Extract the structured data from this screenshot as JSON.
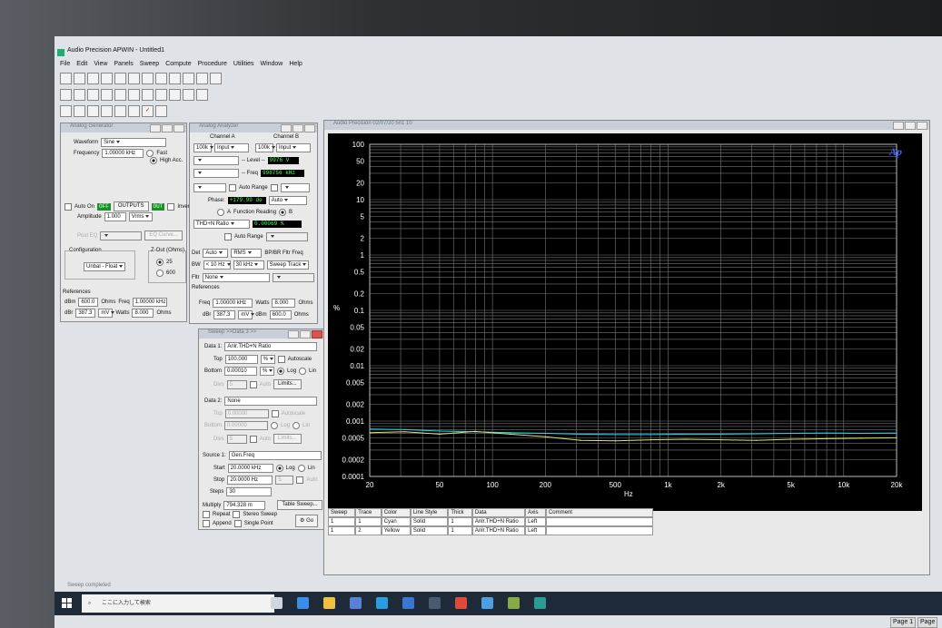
{
  "app": {
    "title": "Audio Precision APWIN - Untitled1",
    "menu": [
      "File",
      "Edit",
      "View",
      "Panels",
      "Sweep",
      "Compute",
      "Procedure",
      "Utilities",
      "Window",
      "Help"
    ]
  },
  "generator": {
    "title": "Analog Generator",
    "waveform_label": "Waveform",
    "waveform_value": "Sine",
    "frequency_label": "Frequency",
    "frequency_value": "1.00000 kHz",
    "fast_label": "Fast",
    "highacc_label": "High Acc.",
    "auto_on_label": "Auto On",
    "off_label": "OFF",
    "outputs_label": "OUTPUTS",
    "out_label": "OUT",
    "invert_label": "Invert",
    "amplitude_label": "Amplitude",
    "amplitude_value": "1.000",
    "amplitude_unit": "Vrms",
    "post_eq_label": "Post EQ",
    "eq_curve_label": "EQ Curve...",
    "configuration_label": "Configuration",
    "configuration_value": "Unbal - Float",
    "zout_label": "Z-Out (Ohms)",
    "z25": "25",
    "z600": "600",
    "references_label": "References",
    "dbm_label": "dBm",
    "dbm_value": "600.0",
    "ohms": "Ohms",
    "freq_label": "Freq",
    "freq_value": "1.00000 kHz",
    "dbv_label": "dBr",
    "dbv_value": "387.3",
    "dbv_unit": "mV",
    "watts_label": "Watts",
    "watts_value": "8.000",
    "watts_unit": "Ohms"
  },
  "analyzer": {
    "title": "Analog Analyzer",
    "ch_a": "Channel A",
    "ch_b": "Channel B",
    "range_a": "100k",
    "input_a": "Input",
    "range_b": "100k",
    "input_b": "Input",
    "level_label": "-- Level --",
    "level_value": "9976",
    "level_unit": "V",
    "freq_label": "-- Freq",
    "freq_value": "998756 kHz",
    "auto_range_label": "Auto Range",
    "phase_label": "Phase:",
    "phase_value": "+179.99",
    "phase_unit": "de",
    "phase_auto": "Auto",
    "func_a": "A",
    "func_reading_label": "Function Reading",
    "func_b": "B",
    "thd_label": "THD+N Ratio",
    "thd_value": "0.00069",
    "thd_unit": "%",
    "det_label": "Det",
    "det_value": "Auto",
    "rms_value": "RMS",
    "bpbr_label": "BP/BR Fltr Freq",
    "bw_label": "BW",
    "bw_low": "< 10 Hz",
    "bw_high": "30 kHz",
    "sweep_track": "Sweep Track",
    "fltr_label": "Fltr",
    "fltr_value": "None",
    "references_label": "References",
    "ref_freq_label": "Freq",
    "ref_freq_value": "1.00000 kHz",
    "ref_watts_label": "Watts",
    "ref_watts_value": "8.000",
    "ref_ohms": "Ohms",
    "ref_dbr_label": "dBr",
    "ref_dbr_value": "387.3",
    "ref_dbr_unit": "mV",
    "ref_dbm_label": "dBm",
    "ref_dbm_value": "600.0",
    "ref_dbm_unit": "Ohms"
  },
  "sweep": {
    "title": "Sweep >>Data 3 >>",
    "data1_label": "Data 1:",
    "data1_value": "Anlr.THD+N Ratio",
    "top_label": "Top",
    "top_value": "100.000",
    "top_unit": "%",
    "autoscale_label": "Autoscale",
    "bottom_label": "Bottom",
    "bottom_value": "0.00010",
    "bottom_unit": "%",
    "log_label": "Log",
    "lin_label": "Lin",
    "div_label": "Divs",
    "div_value": "5",
    "auto_label": "Auto",
    "limits_label": "Limits...",
    "data2_label": "Data 2:",
    "data2_value": "None",
    "top2_value": "0.00000",
    "bottom2_value": "0.00000",
    "source_label": "Source 1:",
    "source_value": "Gen.Freq",
    "start_label": "Start",
    "start_value": "20.0000 kHz",
    "stop_label": "Stop",
    "stop_value": "20.0000 Hz",
    "steps_label": "Steps",
    "steps_value": "30",
    "multiply_label": "Multiply",
    "multiply_value": "794.328 m",
    "table_sweep_label": "Table Sweep...",
    "repeat_label": "Repeat",
    "stereo_label": "Stereo Sweep",
    "append_label": "Append",
    "single_label": "Single Point",
    "go_label": "Go"
  },
  "graph": {
    "title": "Audio Precision   02/07/20 5n1 10",
    "logo": "Ap",
    "ylabel": "%",
    "xlabel": "Hz"
  },
  "chart_data": {
    "type": "line",
    "xscale": "log",
    "yscale": "log",
    "xlim": [
      20,
      20000
    ],
    "ylim": [
      0.0001,
      100
    ],
    "xticks": [
      "20",
      "50",
      "100",
      "200",
      "500",
      "1k",
      "2k",
      "5k",
      "10k",
      "20k"
    ],
    "xtick_values": [
      20,
      50,
      100,
      200,
      500,
      1000,
      2000,
      5000,
      10000,
      20000
    ],
    "yticks": [
      "100",
      "50",
      "20",
      "10",
      "5",
      "2",
      "1",
      "0.5",
      "0.2",
      "0.1",
      "0.05",
      "0.02",
      "0.01",
      "0.005",
      "0.002",
      "0.001",
      "0.0005",
      "0.0002",
      "0.0001"
    ],
    "ytick_values": [
      100,
      50,
      20,
      10,
      5,
      2,
      1,
      0.5,
      0.2,
      0.1,
      0.05,
      0.02,
      0.01,
      0.005,
      0.002,
      0.001,
      0.0005,
      0.0002,
      0.0001
    ],
    "grid": true,
    "xlabel": "Hz",
    "ylabel": "%",
    "series": [
      {
        "color": "#00e5ff",
        "x": [
          20,
          31.7,
          50,
          79.4,
          126,
          200,
          317,
          502,
          796,
          1260,
          2000,
          3170,
          5020,
          7960,
          12600,
          20000
        ],
        "y": [
          0.00072,
          0.0007,
          0.00066,
          0.00064,
          0.00062,
          0.0006,
          0.00058,
          0.00057,
          0.00057,
          0.00058,
          0.00058,
          0.00059,
          0.0006,
          0.00061,
          0.0006,
          0.00061
        ]
      },
      {
        "color": "#e8e070",
        "x": [
          20,
          31.7,
          50,
          79.4,
          126,
          200,
          317,
          502,
          796,
          1260,
          2000,
          3170,
          5020,
          7960,
          12600,
          20000
        ],
        "y": [
          0.00062,
          0.00064,
          0.00058,
          0.00065,
          0.00058,
          0.00052,
          0.00045,
          0.00044,
          0.00046,
          0.00047,
          0.00046,
          0.00045,
          0.00047,
          0.00048,
          0.00049,
          0.0005
        ]
      }
    ]
  },
  "trace_table": {
    "headers": [
      "Sweep",
      "Trace",
      "Color",
      "Line Style",
      "Thick",
      "Data",
      "Axis",
      "Comment"
    ],
    "rows": [
      {
        "sweep": "1",
        "trace": "1",
        "color": "Cyan",
        "style": "Solid",
        "thick": "1",
        "data": "Anlr.THD+N Ratio",
        "axis": "Left",
        "comment": ""
      },
      {
        "sweep": "1",
        "trace": "2",
        "color": "Yellow",
        "style": "Solid",
        "thick": "1",
        "data": "Anlr.THD+N Ratio",
        "axis": "Left",
        "comment": ""
      }
    ]
  },
  "status": "Sweep completed",
  "taskbar": {
    "search_placeholder": "ここに入力して検索",
    "icons": [
      "task-view",
      "edge",
      "file-explorer",
      "store",
      "ie",
      "mail",
      "cortana",
      "chrome",
      "app1",
      "app2",
      "apwin"
    ]
  },
  "page_buttons": [
    "Page 1",
    "Page"
  ]
}
